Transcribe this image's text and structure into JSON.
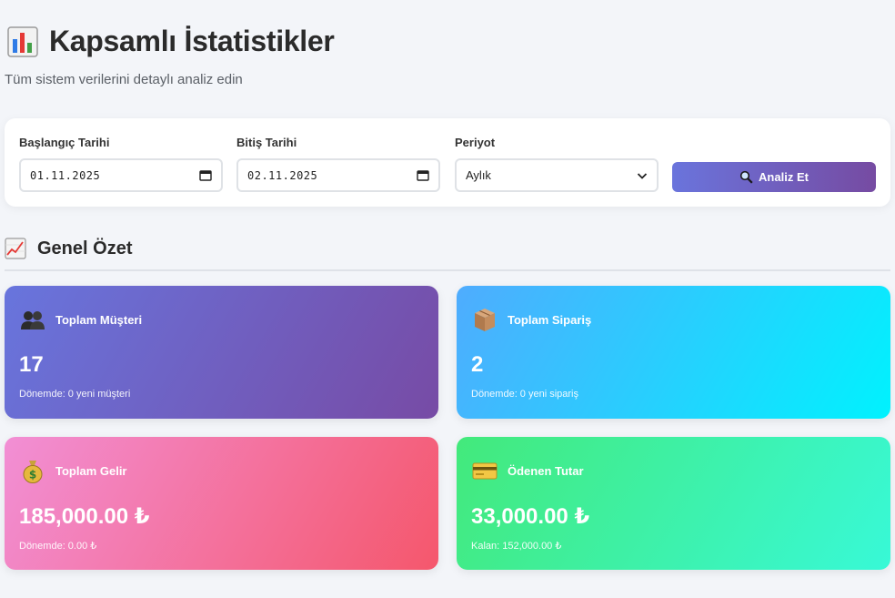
{
  "header": {
    "title": "Kapsamlı İstatistikler",
    "subtitle": "Tüm sistem verilerini detaylı analiz edin",
    "icon": "bar-chart-icon"
  },
  "filters": {
    "start_date": {
      "label": "Başlangıç Tarihi",
      "value": "01.11.2025",
      "icon": "calendar-icon"
    },
    "end_date": {
      "label": "Bitiş Tarihi",
      "value": "02.11.2025",
      "icon": "calendar-icon"
    },
    "period": {
      "label": "Periyot",
      "value": "Aylık",
      "icon": "chevron-down-icon"
    },
    "analyze_button": {
      "label": "Analiz Et",
      "icon": "search-icon"
    }
  },
  "section": {
    "title": "Genel Özet",
    "icon": "trend-chart-icon"
  },
  "stats": [
    {
      "label": "Toplam Müşteri",
      "value": "17",
      "note": "Dönemde: 0 yeni müşteri",
      "icon": "users-icon"
    },
    {
      "label": "Toplam Sipariş",
      "value": "2",
      "note": "Dönemde: 0 yeni sipariş",
      "icon": "package-icon"
    },
    {
      "label": "Toplam Gelir",
      "value": "185,000.00 ₺",
      "note": "Dönemde: 0.00 ₺",
      "icon": "money-bag-icon"
    },
    {
      "label": "Ödenen Tutar",
      "value": "33,000.00 ₺",
      "note": "Kalan: 152,000.00 ₺",
      "icon": "credit-card-icon"
    }
  ],
  "colors": {
    "primary_gradient": [
      "#667eea",
      "#764ba2"
    ],
    "orders_gradient": [
      "#4facfe",
      "#00f2fe"
    ],
    "revenue_gradient": [
      "#f093fb",
      "#f5576c"
    ],
    "paid_gradient": [
      "#43e97b",
      "#38f9d7"
    ]
  }
}
